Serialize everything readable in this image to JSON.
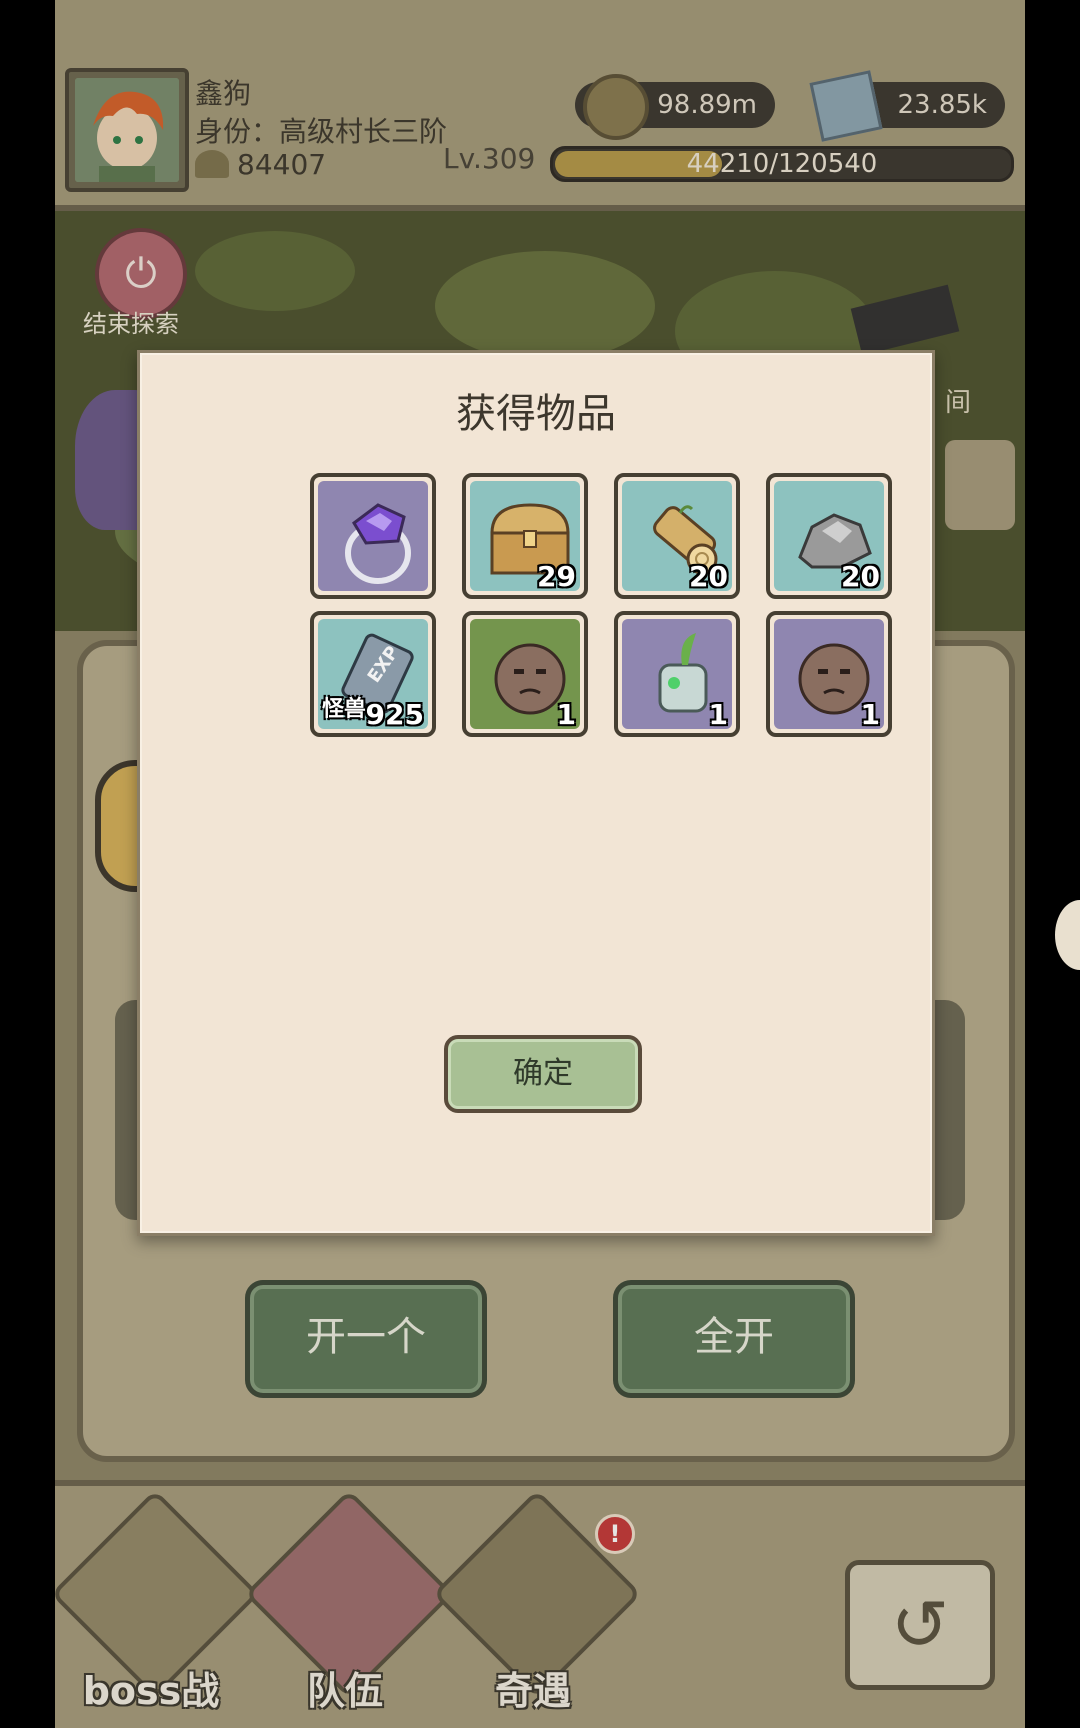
{
  "player": {
    "name": "鑫狗",
    "title": "身份：高级村长三阶",
    "power": "84407",
    "level": "Lv.309",
    "exp_text": "44210/120540",
    "exp_fraction": 0.367
  },
  "resources": {
    "coin": "98.89m",
    "crystal": "23.85k"
  },
  "scene": {
    "end_explore_label": "结束探索",
    "side_text": "间"
  },
  "modal": {
    "title": "获得物品",
    "confirm_label": "确定",
    "items": [
      {
        "name": "amethyst-ring",
        "count": "",
        "sub": ""
      },
      {
        "name": "treasure-chest",
        "count": "29",
        "sub": ""
      },
      {
        "name": "wood-log",
        "count": "20",
        "sub": ""
      },
      {
        "name": "stone-ore",
        "count": "20",
        "sub": ""
      },
      {
        "name": "monster-exp-book",
        "count": "925",
        "sub": "怪兽"
      },
      {
        "name": "rock-golem-green",
        "count": "1",
        "sub": ""
      },
      {
        "name": "plant-robot",
        "count": "1",
        "sub": ""
      },
      {
        "name": "rock-golem-purple",
        "count": "1",
        "sub": ""
      }
    ]
  },
  "buttons": {
    "open_one": "开一个",
    "open_all": "全开"
  },
  "nav": {
    "boss": "boss战",
    "team": "队伍",
    "encounter": "奇遇",
    "notification": "!"
  },
  "colors": {
    "frame_purple": "#8f86b0",
    "frame_teal": "#8dc2bf",
    "frame_green": "#74954d",
    "button_green": "#5f7a5a",
    "notification_red": "#c63b3b"
  }
}
